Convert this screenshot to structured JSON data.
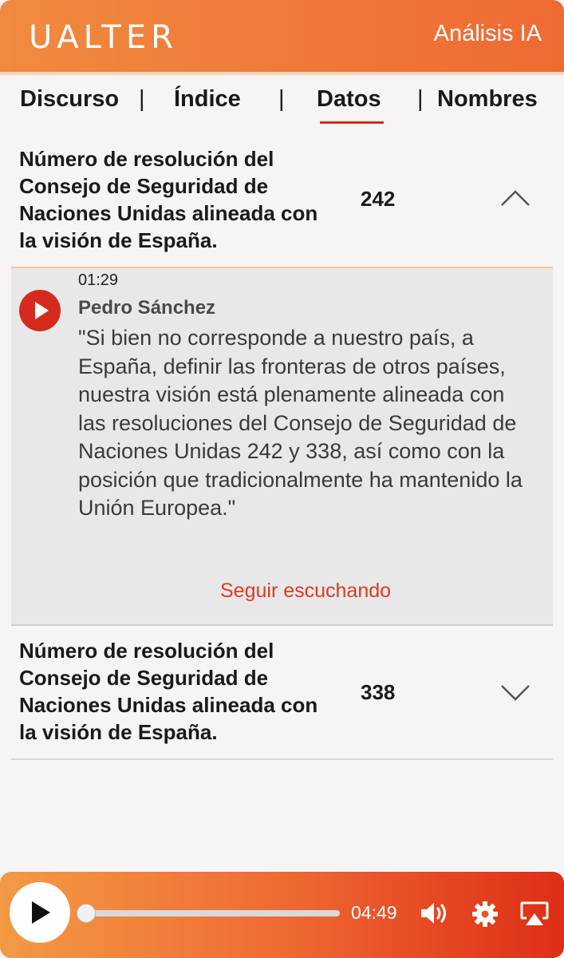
{
  "header": {
    "logo": "UALTER",
    "title": "Análisis IA"
  },
  "tabs": [
    {
      "label": "Discurso"
    },
    {
      "label": "Índice"
    },
    {
      "label": "Datos",
      "active": true
    },
    {
      "label": "Nombres"
    }
  ],
  "tab_separator": "|",
  "data_items": [
    {
      "title": "Número de resolución del Consejo de Seguridad de Naciones Unidas alineada con la visión de España.",
      "value": "242",
      "expanded": true,
      "quote": {
        "time": "01:29",
        "speaker": "Pedro Sánchez",
        "text": "\"Si bien no corresponde a nuestro país, a España, definir las fronteras de otros países, nuestra visión está plenamente alineada con las resoluciones del Consejo de Seguridad de Naciones Unidas 242 y 338, así como con la posición que tradicionalmente ha mantenido la Unión Europea.\"",
        "continue_label": "Seguir escuchando"
      }
    },
    {
      "title": "Número de resolución del Consejo de Seguridad de Naciones Unidas alineada con la visión de España.",
      "value": "338",
      "expanded": false
    }
  ],
  "player": {
    "duration": "04:49",
    "progress": 0.0
  },
  "icons": {
    "collapse": "chevron-up-icon",
    "expand": "chevron-down-icon",
    "play": "play-icon",
    "volume": "volume-icon",
    "settings": "gear-icon",
    "cast": "airplay-icon"
  },
  "colors": {
    "accent_orange": "#ef7a3a",
    "accent_red": "#d52b1e",
    "link_red": "#dd3b1e"
  }
}
